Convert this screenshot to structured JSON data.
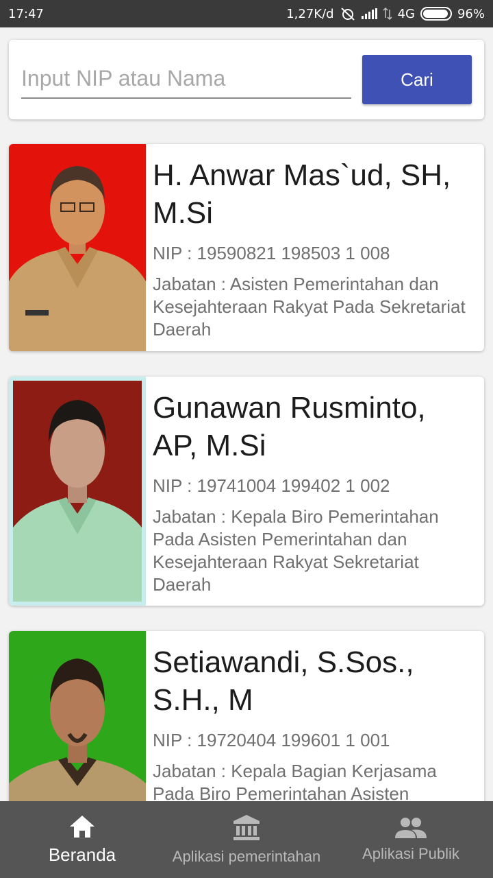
{
  "status_bar": {
    "time": "17:47",
    "network_speed": "1,27K/d",
    "network_type": "4G",
    "battery": "96%",
    "battery_level": 0.96,
    "icons": [
      "mute-alarm-icon",
      "signal-icon",
      "data-arrows-icon",
      "battery-icon"
    ]
  },
  "search": {
    "placeholder": "Input NIP atau Nama",
    "value": "",
    "button_label": "Cari",
    "button_color": "#3f51b5"
  },
  "employees": [
    {
      "name": "H. Anwar Mas`ud, SH, M.Si",
      "nip": "NIP : 19590821 198503 1 008",
      "jabatan": "Jabatan : Asisten Pemerintahan dan Kesejahteraan Rakyat Pada Sekretariat Daerah",
      "photo_background": "#e3120b"
    },
    {
      "name": "Gunawan Rusminto, AP, M.Si",
      "nip": "NIP : 19741004 199402 1 002",
      "jabatan": "Jabatan : Kepala Biro Pemerintahan Pada Asisten Pemerintahan dan Kesejahteraan Rakyat Sekretariat Daerah",
      "photo_background": "#8c1c14"
    },
    {
      "name": "Setiawandi, S.Sos., S.H., M",
      "nip": "NIP : 19720404 199601 1 001",
      "jabatan": "Jabatan : Kepala Bagian Kerjasama Pada Biro Pemerintahan Asisten",
      "photo_background": "#2ea81a"
    }
  ],
  "bottom_nav": {
    "items": [
      {
        "label": "Beranda",
        "icon": "home-icon",
        "active": true
      },
      {
        "label": "Aplikasi pemerintahan",
        "icon": "institution-icon",
        "active": false
      },
      {
        "label": "Aplikasi Publik",
        "icon": "people-icon",
        "active": false
      }
    ]
  }
}
